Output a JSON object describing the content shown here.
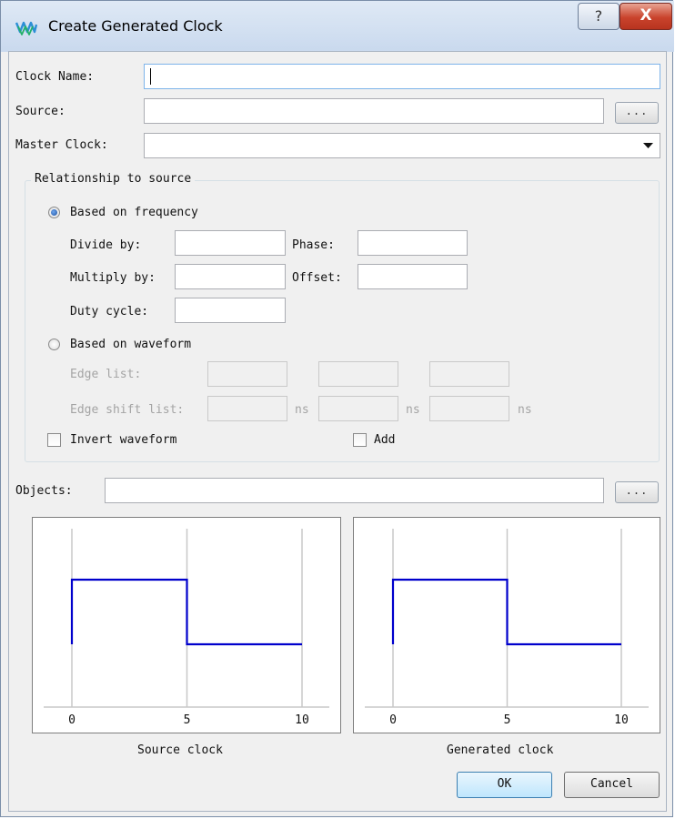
{
  "window": {
    "title": "Create Generated Clock",
    "help_label": "?",
    "close_label": "X"
  },
  "form": {
    "clock_name_label": "Clock Name:",
    "clock_name_value": "",
    "source_label": "Source:",
    "source_value": "",
    "master_clock_label": "Master Clock:",
    "master_clock_value": "",
    "browse_label": "...",
    "objects_label": "Objects:",
    "objects_value": ""
  },
  "relationship": {
    "group_title": "Relationship to source",
    "frequency": {
      "label": "Based on frequency",
      "selected": true,
      "divide_by_label": "Divide by:",
      "divide_by_value": "",
      "phase_label": "Phase:",
      "phase_value": "",
      "multiply_by_label": "Multiply by:",
      "multiply_by_value": "",
      "offset_label": "Offset:",
      "offset_value": "",
      "duty_cycle_label": "Duty cycle:",
      "duty_cycle_value": ""
    },
    "waveform": {
      "label": "Based on waveform",
      "selected": false,
      "edge_list_label": "Edge list:",
      "edge_shift_list_label": "Edge shift list:",
      "unit": "ns"
    },
    "invert_waveform_label": "Invert waveform",
    "invert_waveform_checked": false,
    "add_label": "Add",
    "add_checked": false
  },
  "chart_data": [
    {
      "type": "line",
      "title": "Source clock",
      "x_ticks": [
        "0",
        "5",
        "10"
      ],
      "xlim": [
        0,
        10
      ],
      "ylim": [
        0,
        1
      ],
      "series": [
        {
          "x": [
            0,
            0,
            5,
            5,
            10
          ],
          "y": [
            0,
            1,
            1,
            0,
            0
          ]
        }
      ],
      "color": "#0000cc",
      "grid": true
    },
    {
      "type": "line",
      "title": "Generated clock",
      "x_ticks": [
        "0",
        "5",
        "10"
      ],
      "xlim": [
        0,
        10
      ],
      "ylim": [
        0,
        1
      ],
      "series": [
        {
          "x": [
            0,
            0,
            5,
            5,
            10
          ],
          "y": [
            0,
            1,
            1,
            0,
            0
          ]
        }
      ],
      "color": "#0000cc",
      "grid": true
    }
  ],
  "buttons": {
    "ok_label": "OK",
    "cancel_label": "Cancel"
  },
  "colors": {
    "waveform": "#0000cc",
    "close_button": "#c9432c"
  }
}
